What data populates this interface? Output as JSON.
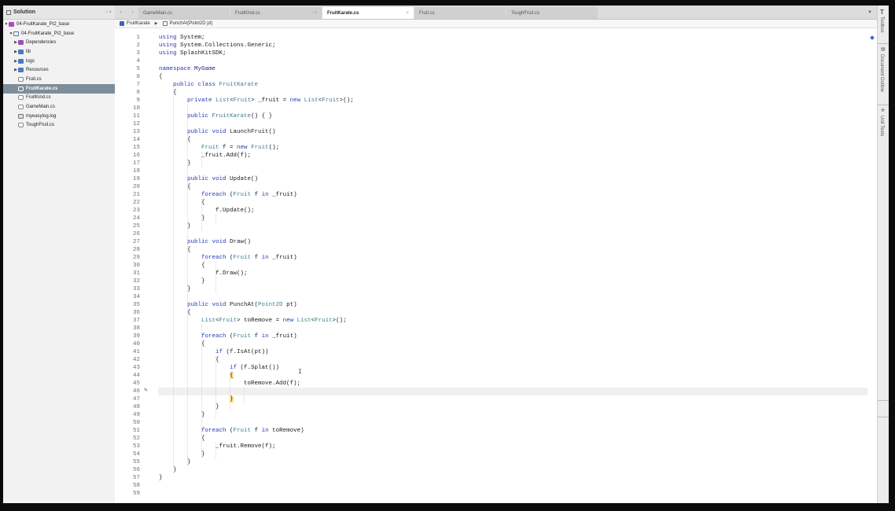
{
  "solution": {
    "title": "Solution",
    "controls": "▫ ×",
    "items": [
      {
        "label": "04-FruitKarate_Pt2_base",
        "indent": 0,
        "icon": "sln",
        "tri": "▼",
        "selected": false
      },
      {
        "label": "04-FruitKarate_Pt2_base",
        "indent": 1,
        "icon": "proj",
        "tri": "▼",
        "selected": false
      },
      {
        "label": "Dependencies",
        "indent": 2,
        "icon": "folder-dep",
        "tri": "▶",
        "selected": false
      },
      {
        "label": "lib",
        "indent": 2,
        "icon": "folder",
        "tri": "▶",
        "selected": false
      },
      {
        "label": "logs",
        "indent": 2,
        "icon": "folder",
        "tri": "▶",
        "selected": false
      },
      {
        "label": "Resources",
        "indent": 2,
        "icon": "folder",
        "tri": "▶",
        "selected": false
      },
      {
        "label": "Fruit.cs",
        "indent": 2,
        "icon": "file",
        "tri": "",
        "selected": false
      },
      {
        "label": "FruitKarate.cs",
        "indent": 2,
        "icon": "file",
        "tri": "",
        "selected": true
      },
      {
        "label": "FruitKind.cs",
        "indent": 2,
        "icon": "file",
        "tri": "",
        "selected": false
      },
      {
        "label": "GameMain.cs",
        "indent": 2,
        "icon": "file",
        "tri": "",
        "selected": false
      },
      {
        "label": "myeasylog.log",
        "indent": 2,
        "icon": "log",
        "tri": "",
        "selected": false
      },
      {
        "label": "ToughFruit.cs",
        "indent": 2,
        "icon": "file",
        "tri": "",
        "selected": false
      }
    ]
  },
  "nav": {
    "back": "‹",
    "forward": "›"
  },
  "tabs": [
    {
      "label": "GameMain.cs",
      "active": false,
      "close": ""
    },
    {
      "label": "FruitKind.cs",
      "active": false,
      "close": "▫ ×"
    },
    {
      "label": "FruitKarate.cs",
      "active": true,
      "close": "×"
    },
    {
      "label": "Fruit.cs",
      "active": false,
      "close": ""
    },
    {
      "label": "ToughFruit.cs",
      "active": false,
      "close": ""
    }
  ],
  "tab_dropdown": "▼",
  "breadcrumb": {
    "class_name": "FruitKarate",
    "separator": "▶",
    "member": "PunchAt(Point2D pt)"
  },
  "editor": {
    "current_line": 46,
    "lines": [
      "<span class=kw>using</span> System;",
      "<span class=kw>using</span> System.Collections.Generic;",
      "<span class=kw>using</span> SplashKitSDK;",
      "",
      "<span class=kw>namespace</span> <span class=nm>MyGame</span>",
      "{",
      "    <span class=kw>public class</span> <span class=ty>FruitKarate</span>",
      "    {",
      "        <span class=kw>private</span> <span class=ty>List</span>&lt;<span class=ty>Fruit</span>&gt; _fruit = <span class=kw>new</span> <span class=ty>List</span>&lt;<span class=ty>Fruit</span>&gt;();",
      "",
      "        <span class=kw>public</span> <span class=ty>FruitKarate</span>() { }",
      "",
      "        <span class=kw>public void</span> LaunchFruit()",
      "        {",
      "            <span class=ty>Fruit</span> f = <span class=kw>new</span> <span class=ty>Fruit</span>();",
      "            _fruit.Add(f);",
      "        }",
      "",
      "        <span class=kw>public void</span> Update()",
      "        {",
      "            <span class=kw>foreach</span> (<span class=ty>Fruit</span> f <span class=kw>in</span> _fruit)",
      "            {",
      "                f.Update();",
      "            }",
      "        }",
      "",
      "        <span class=kw>public void</span> Draw()",
      "        {",
      "            <span class=kw>foreach</span> (<span class=ty>Fruit</span> f <span class=kw>in</span> _fruit)",
      "            {",
      "                f.Draw();",
      "            }",
      "        }",
      "",
      "        <span class=kw>public void</span> PunchAt(<span class=ty>Point2D</span> pt)",
      "        {",
      "            <span class=ty>List</span>&lt;<span class=ty>Fruit</span>&gt; toRemove = <span class=kw>new</span> <span class=ty>List</span>&lt;<span class=ty>Fruit</span>&gt;();",
      "",
      "            <span class=kw>foreach</span> (<span class=ty>Fruit</span> f <span class=kw>in</span> _fruit)",
      "            {",
      "                <span class=kw>if</span> (f.IsAt(pt))",
      "                {",
      "                    <span class=kw>if</span> (f.Splat())",
      "                    <span class=bracehl>{</span>",
      "                        toRemove.Add(f);",
      "",
      "                    <span class=bracehl>}</span>",
      "                }",
      "            }",
      "",
      "            <span class=kw>foreach</span> (<span class=ty>Fruit</span> f <span class=kw>in</span> toRemove)",
      "            {",
      "                _fruit.Remove(f);",
      "            }",
      "        }",
      "    }",
      "}",
      "",
      ""
    ]
  },
  "pads": {
    "toolbox": "Toolbox",
    "document_outline": "Document Outline",
    "unit_tests": "Unit Tests"
  }
}
